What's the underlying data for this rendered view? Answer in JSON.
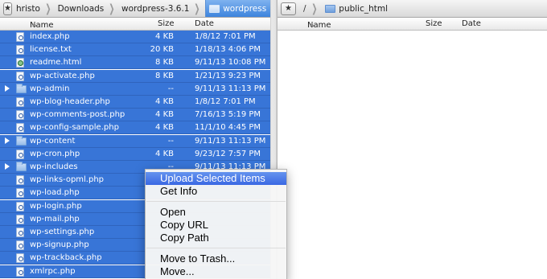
{
  "left_pane": {
    "breadcrumb": [
      {
        "label": "hristo"
      },
      {
        "label": "Downloads"
      },
      {
        "label": "wordpress-3.6.1"
      },
      {
        "label": "wordpress",
        "active": true
      }
    ],
    "columns": {
      "name": "Name",
      "size": "Size",
      "date": "Date"
    },
    "files": [
      {
        "name": "index.php",
        "size": "4 KB",
        "date": "1/8/12 7:01 PM",
        "icon": "php-file-icon"
      },
      {
        "name": "license.txt",
        "size": "20 KB",
        "date": "1/18/13 4:06 PM",
        "icon": "text-file-icon"
      },
      {
        "name": "readme.html",
        "size": "8 KB",
        "date": "9/11/13 10:08 PM",
        "icon": "html-file-icon"
      },
      {
        "name": "wp-activate.php",
        "size": "8 KB",
        "date": "1/21/13 9:23 PM",
        "icon": "php-file-icon"
      },
      {
        "name": "wp-admin",
        "size": "--",
        "date": "9/11/13 11:13 PM",
        "icon": "folder-icon",
        "folder": true
      },
      {
        "name": "wp-blog-header.php",
        "size": "4 KB",
        "date": "1/8/12 7:01 PM",
        "icon": "php-file-icon"
      },
      {
        "name": "wp-comments-post.php",
        "size": "4 KB",
        "date": "7/16/13 5:19 PM",
        "icon": "php-file-icon"
      },
      {
        "name": "wp-config-sample.php",
        "size": "4 KB",
        "date": "11/1/10 4:45 PM",
        "icon": "php-file-icon"
      },
      {
        "name": "wp-content",
        "size": "--",
        "date": "9/11/13 11:13 PM",
        "icon": "folder-icon",
        "folder": true
      },
      {
        "name": "wp-cron.php",
        "size": "4 KB",
        "date": "9/23/12 7:57 PM",
        "icon": "php-file-icon"
      },
      {
        "name": "wp-includes",
        "size": "--",
        "date": "9/11/13 11:13 PM",
        "icon": "folder-icon",
        "folder": true
      },
      {
        "name": "wp-links-opml.php",
        "size": "",
        "date": "",
        "icon": "php-file-icon"
      },
      {
        "name": "wp-load.php",
        "size": "",
        "date": "",
        "icon": "php-file-icon"
      },
      {
        "name": "wp-login.php",
        "size": "",
        "date": "",
        "icon": "php-file-icon"
      },
      {
        "name": "wp-mail.php",
        "size": "",
        "date": "",
        "icon": "php-file-icon"
      },
      {
        "name": "wp-settings.php",
        "size": "",
        "date": "",
        "icon": "php-file-icon"
      },
      {
        "name": "wp-signup.php",
        "size": "",
        "date": "",
        "icon": "php-file-icon"
      },
      {
        "name": "wp-trackback.php",
        "size": "",
        "date": "",
        "icon": "php-file-icon"
      },
      {
        "name": "xmlrpc.php",
        "size": "",
        "date": "",
        "icon": "php-file-icon"
      }
    ]
  },
  "right_pane": {
    "up_label": "/",
    "breadcrumb": [
      {
        "label": "public_html"
      }
    ],
    "columns": {
      "name": "Name",
      "size": "Size",
      "date": "Date"
    },
    "files": []
  },
  "context_menu": {
    "groups": [
      [
        {
          "label": "Upload Selected Items",
          "highlighted": true
        },
        {
          "label": "Get Info"
        }
      ],
      [
        {
          "label": "Open"
        },
        {
          "label": "Copy URL"
        },
        {
          "label": "Copy Path"
        }
      ],
      [
        {
          "label": "Move to Trash..."
        },
        {
          "label": "Move..."
        }
      ]
    ]
  },
  "colors": {
    "selection": "#3875d7",
    "menu_highlight": "#3a68e3",
    "active_crumb": "#3d84dd"
  },
  "icons": {
    "favorites": "star-icon",
    "sort_indicator": "sort-ascending-icon",
    "disclosure": "disclosure-triangle-icon",
    "dropdown": "chevron-down-icon"
  }
}
